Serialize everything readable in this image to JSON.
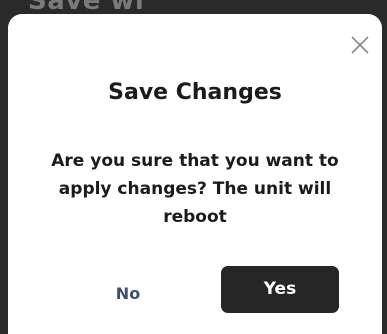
{
  "background": {
    "partial_text": "Save wi"
  },
  "dialog": {
    "title": "Save Changes",
    "message": "Are you sure that you want to apply changes? The unit will reboot",
    "close_icon": "close-icon",
    "buttons": {
      "no_label": "No",
      "yes_label": "Yes"
    }
  },
  "colors": {
    "backdrop": "#2a2a2a",
    "dialog_bg": "#ffffff",
    "primary_button": "#262626",
    "secondary_text": "#3c5068"
  }
}
